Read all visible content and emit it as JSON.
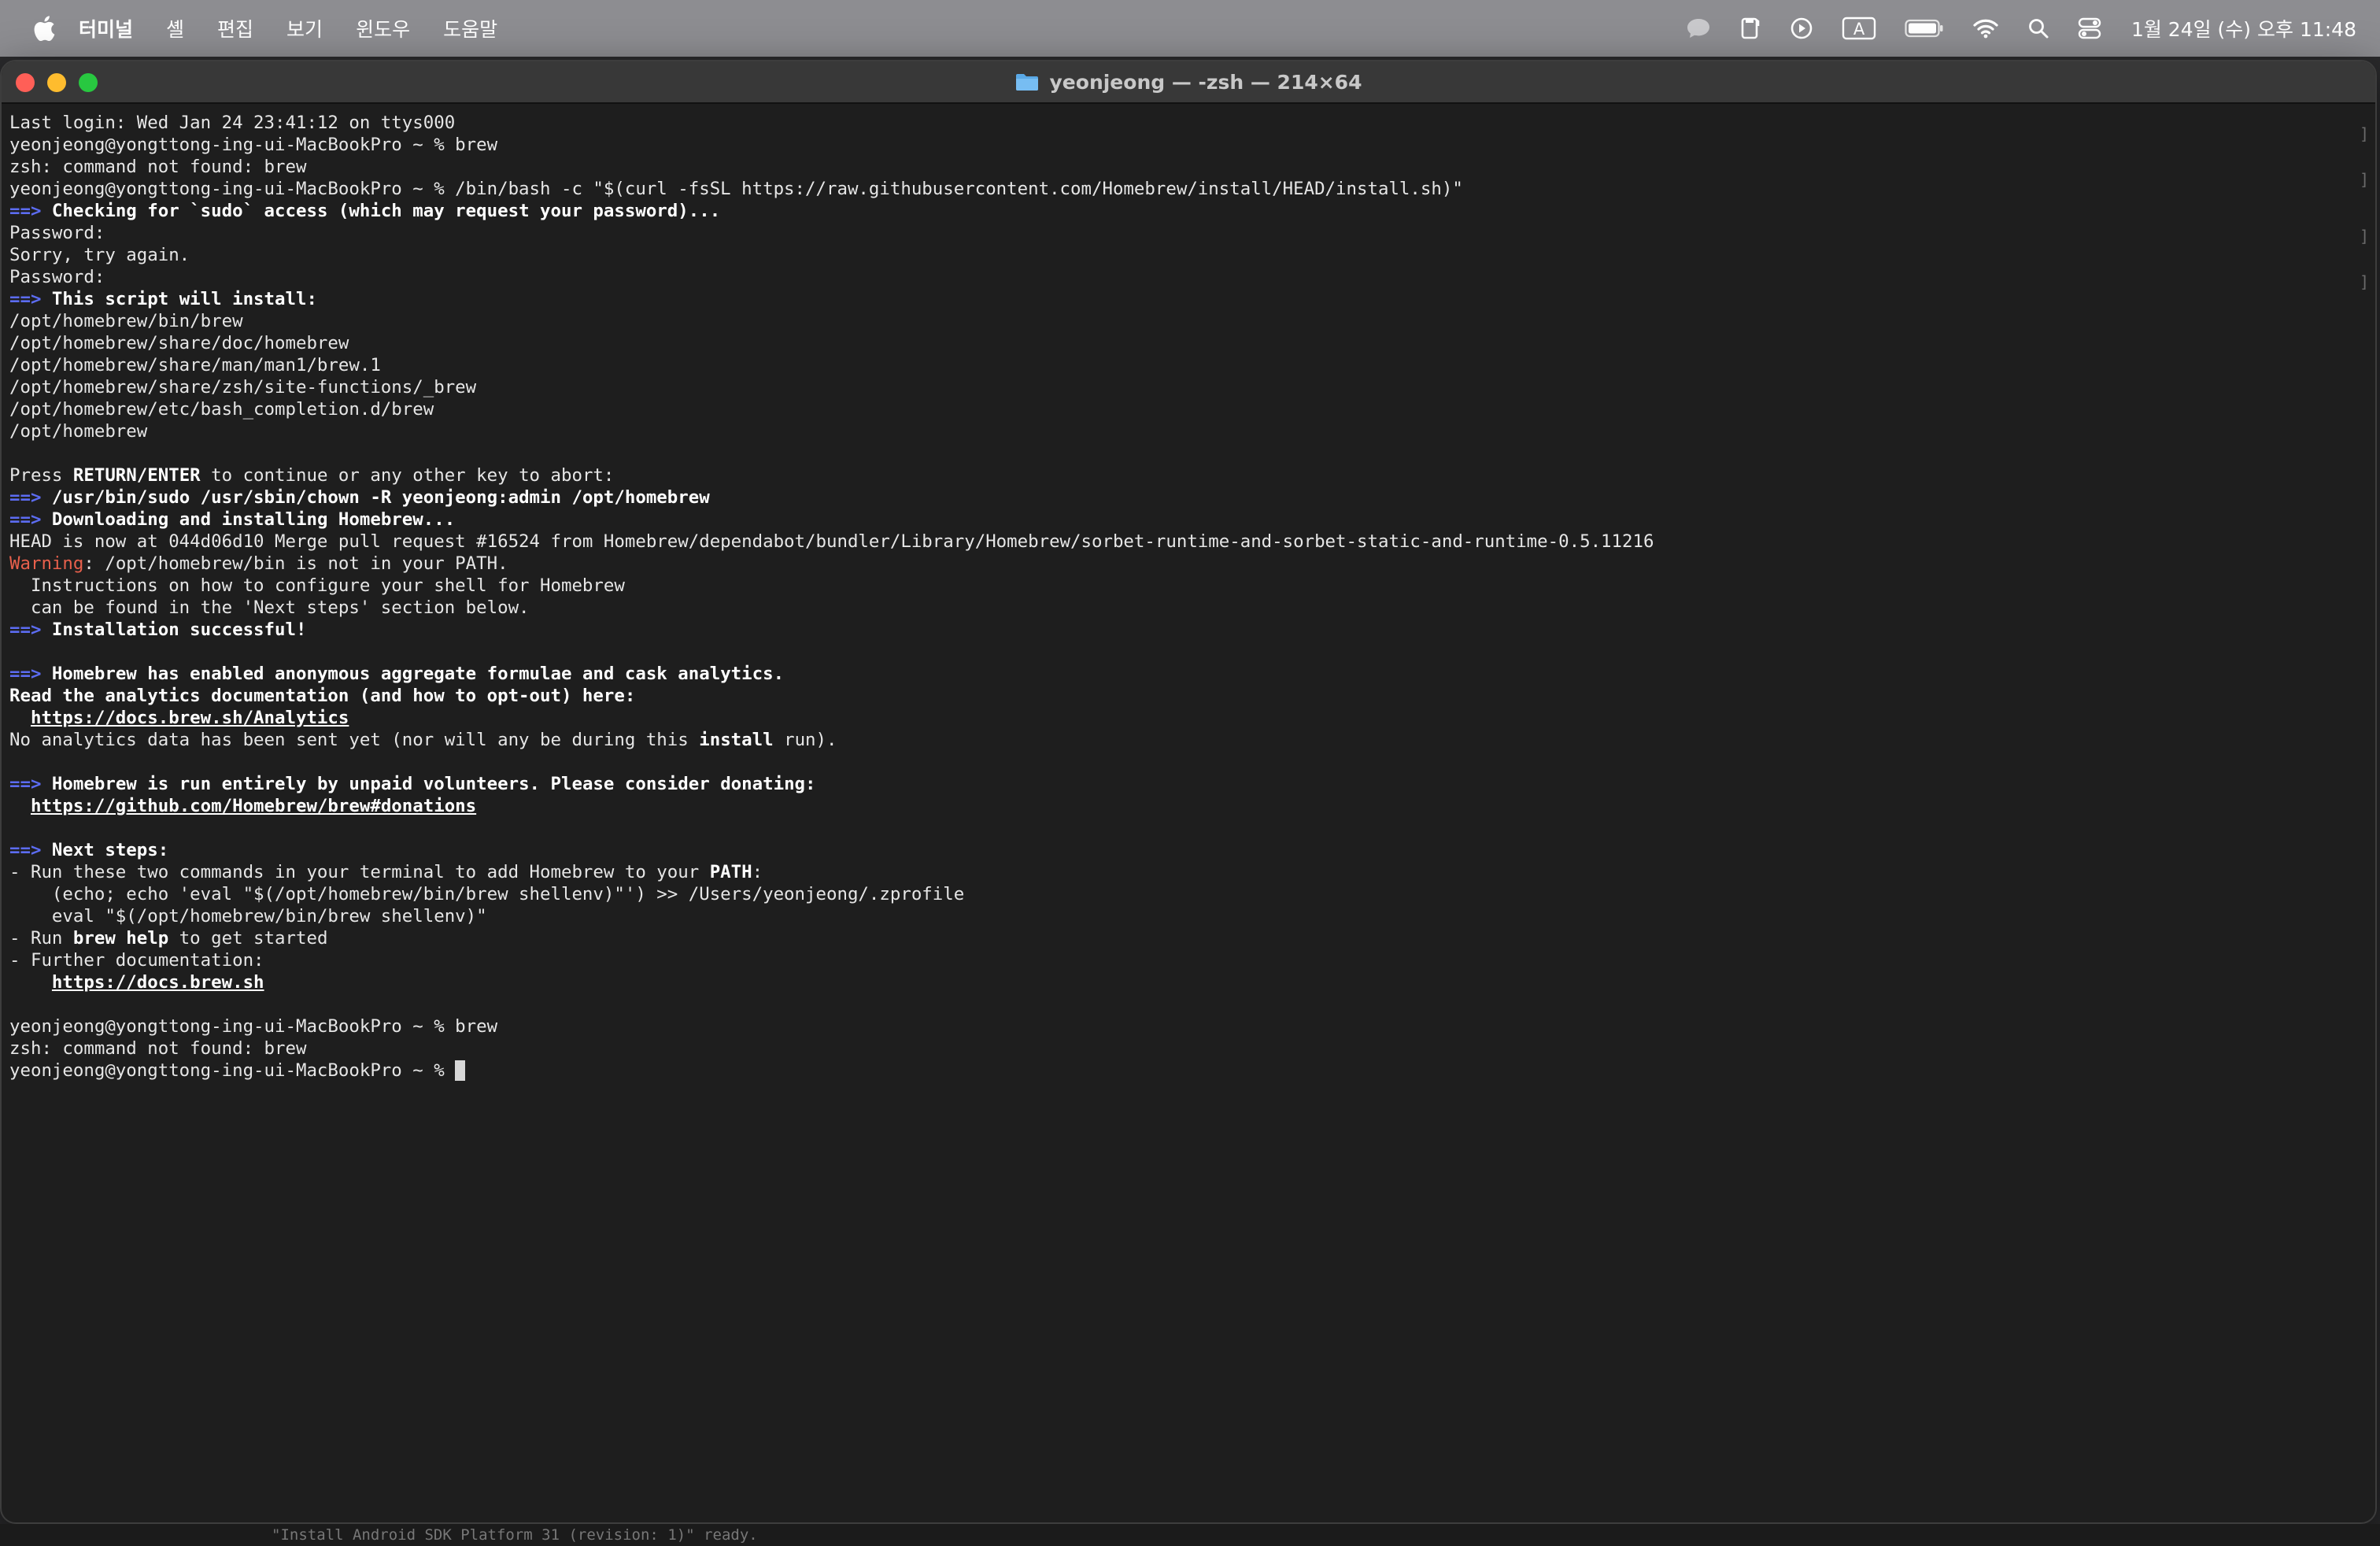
{
  "menubar": {
    "app_name": "터미널",
    "items": [
      "셸",
      "편집",
      "보기",
      "윈도우",
      "도움말"
    ],
    "clock": "1월 24일 (수) 오후 11:48",
    "status_icons": [
      "chat-icon",
      "notes-icon",
      "play-icon",
      "input-source-icon",
      "battery-icon",
      "wifi-icon",
      "spotlight-icon",
      "control-center-icon"
    ],
    "input_source_label": "A"
  },
  "window": {
    "title": "yeonjeong — -zsh — 214×64"
  },
  "terminal": {
    "lines": [
      [
        {
          "t": "Last login: Wed Jan 24 23:41:12 on ttys000"
        }
      ],
      [
        {
          "t": "yeonjeong@yongttong-ing-ui-MacBookPro ~ % brew"
        }
      ],
      [
        {
          "t": "zsh: command not found: brew"
        }
      ],
      [
        {
          "t": "yeonjeong@yongttong-ing-ui-MacBookPro ~ % /bin/bash -c \"$(curl -fsSL https://raw.githubusercontent.com/Homebrew/install/HEAD/install.sh)\""
        }
      ],
      [
        {
          "t": "==>",
          "s": "arrow"
        },
        {
          "t": " Checking for `sudo` access (which may request your password)...",
          "s": "bold"
        }
      ],
      [
        {
          "t": "Password:"
        }
      ],
      [
        {
          "t": "Sorry, try again."
        }
      ],
      [
        {
          "t": "Password:"
        }
      ],
      [
        {
          "t": "==>",
          "s": "arrow"
        },
        {
          "t": " This script will install:",
          "s": "bold"
        }
      ],
      [
        {
          "t": "/opt/homebrew/bin/brew"
        }
      ],
      [
        {
          "t": "/opt/homebrew/share/doc/homebrew"
        }
      ],
      [
        {
          "t": "/opt/homebrew/share/man/man1/brew.1"
        }
      ],
      [
        {
          "t": "/opt/homebrew/share/zsh/site-functions/_brew"
        }
      ],
      [
        {
          "t": "/opt/homebrew/etc/bash_completion.d/brew"
        }
      ],
      [
        {
          "t": "/opt/homebrew"
        }
      ],
      [
        {
          "t": ""
        }
      ],
      [
        {
          "t": "Press "
        },
        {
          "t": "RETURN/ENTER",
          "s": "bold"
        },
        {
          "t": " to continue or any other key to abort:"
        }
      ],
      [
        {
          "t": "==>",
          "s": "arrow"
        },
        {
          "t": " /usr/bin/sudo /usr/sbin/chown -R yeonjeong:admin /opt/homebrew",
          "s": "bold"
        }
      ],
      [
        {
          "t": "==>",
          "s": "arrow"
        },
        {
          "t": " Downloading and installing Homebrew...",
          "s": "bold"
        }
      ],
      [
        {
          "t": "HEAD is now at 044d06d10 Merge pull request #16524 from Homebrew/dependabot/bundler/Library/Homebrew/sorbet-runtime-and-sorbet-static-and-runtime-0.5.11216"
        }
      ],
      [
        {
          "t": "Warning",
          "s": "warn"
        },
        {
          "t": ": /opt/homebrew/bin is not in your PATH."
        }
      ],
      [
        {
          "t": "  Instructions on how to configure your shell for Homebrew"
        }
      ],
      [
        {
          "t": "  can be found in the 'Next steps' section below."
        }
      ],
      [
        {
          "t": "==>",
          "s": "arrow"
        },
        {
          "t": " Installation successful!",
          "s": "bold"
        }
      ],
      [
        {
          "t": ""
        }
      ],
      [
        {
          "t": "==>",
          "s": "arrow"
        },
        {
          "t": " Homebrew has enabled anonymous aggregate formulae and cask analytics.",
          "s": "bold"
        }
      ],
      [
        {
          "t": "Read the analytics documentation (and how to opt-out) here:",
          "s": "bold"
        }
      ],
      [
        {
          "t": "  "
        },
        {
          "t": "https://docs.brew.sh/Analytics",
          "s": "link"
        }
      ],
      [
        {
          "t": "No analytics data has been sent yet (nor will any be during this "
        },
        {
          "t": "install",
          "s": "bold"
        },
        {
          "t": " run)."
        }
      ],
      [
        {
          "t": ""
        }
      ],
      [
        {
          "t": "==>",
          "s": "arrow"
        },
        {
          "t": " Homebrew is run entirely by unpaid volunteers. Please consider donating:",
          "s": "bold"
        }
      ],
      [
        {
          "t": "  "
        },
        {
          "t": "https://github.com/Homebrew/brew#donations",
          "s": "link"
        }
      ],
      [
        {
          "t": ""
        }
      ],
      [
        {
          "t": "==>",
          "s": "arrow"
        },
        {
          "t": " Next steps:",
          "s": "bold"
        }
      ],
      [
        {
          "t": "- Run these two commands in your terminal to add Homebrew to your "
        },
        {
          "t": "PATH",
          "s": "bold"
        },
        {
          "t": ":"
        }
      ],
      [
        {
          "t": "    (echo; echo 'eval \"$(/opt/homebrew/bin/brew shellenv)\"') >> /Users/yeonjeong/.zprofile"
        }
      ],
      [
        {
          "t": "    eval \"$(/opt/homebrew/bin/brew shellenv)\""
        }
      ],
      [
        {
          "t": "- Run "
        },
        {
          "t": "brew help",
          "s": "bold"
        },
        {
          "t": " to get started"
        }
      ],
      [
        {
          "t": "- Further documentation:"
        }
      ],
      [
        {
          "t": "    "
        },
        {
          "t": "https://docs.brew.sh",
          "s": "link"
        }
      ],
      [
        {
          "t": ""
        }
      ],
      [
        {
          "t": "yeonjeong@yongttong-ing-ui-MacBookPro ~ % brew"
        }
      ],
      [
        {
          "t": "zsh: command not found: brew"
        }
      ],
      [
        {
          "t": "yeonjeong@yongttong-ing-ui-MacBookPro ~ % "
        },
        {
          "t": "",
          "s": "cursor"
        }
      ]
    ]
  },
  "background_text": "\"Install Android SDK Platform 31 (revision: 1)\" ready.",
  "colors": {
    "arrow": "#5c6cf2",
    "warning": "#e8604c",
    "terminal_bg": "#1e1e1e"
  }
}
